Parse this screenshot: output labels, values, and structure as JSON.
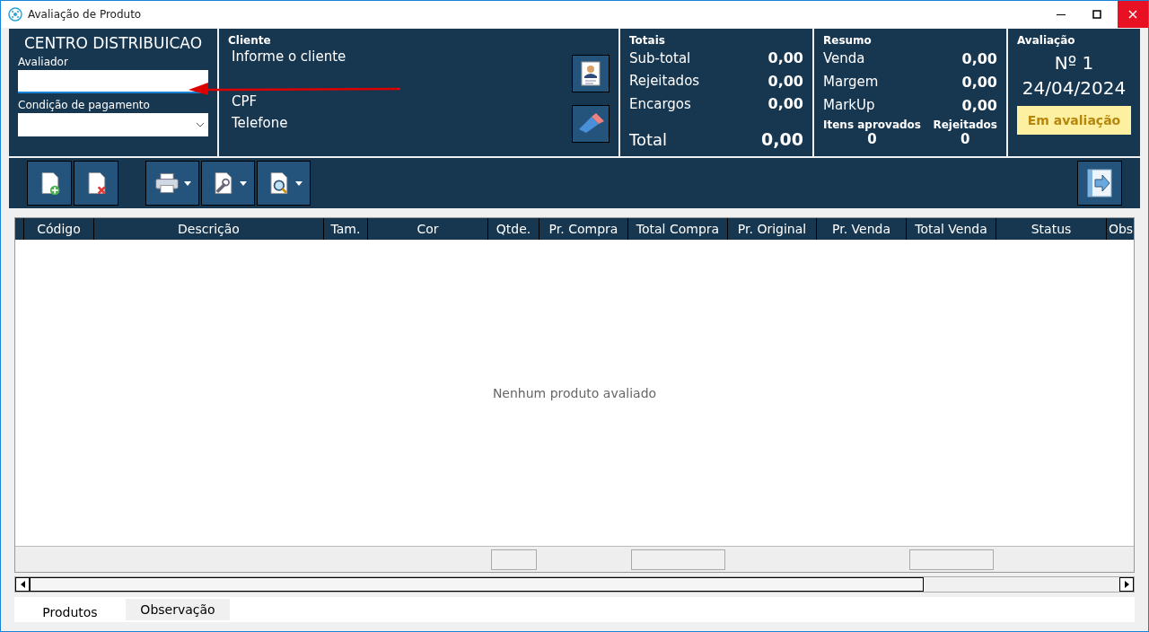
{
  "window": {
    "title": "Avaliação de Produto"
  },
  "centro": {
    "title": "CENTRO DISTRIBUICAO",
    "avaliador_label": "Avaliador",
    "condicao_label": "Condição de pagamento"
  },
  "cliente": {
    "heading": "Cliente",
    "name": "Informe o cliente",
    "cpf_label": "CPF",
    "telefone_label": "Telefone"
  },
  "totais": {
    "heading": "Totais",
    "rows": [
      {
        "label": "Sub-total",
        "value": "0,00"
      },
      {
        "label": "Rejeitados",
        "value": "0,00"
      },
      {
        "label": "Encargos",
        "value": "0,00"
      }
    ],
    "total_label": "Total",
    "total_value": "0,00"
  },
  "resumo": {
    "heading": "Resumo",
    "rows": [
      {
        "label": "Venda",
        "value": "0,00"
      },
      {
        "label": "Margem",
        "value": "0,00"
      },
      {
        "label": "MarkUp",
        "value": "0,00"
      }
    ],
    "counts": [
      {
        "label": "Itens aprovados",
        "value": "0"
      },
      {
        "label": "Rejeitados",
        "value": "0"
      }
    ]
  },
  "avaliacao": {
    "heading": "Avaliação",
    "number": "Nº 1",
    "date": "24/04/2024",
    "status": "Em avaliação"
  },
  "toolbar": [
    {
      "kind": "new",
      "dropdown": false
    },
    {
      "kind": "delete",
      "dropdown": false
    },
    {
      "kind": "print",
      "dropdown": true
    },
    {
      "kind": "tools",
      "dropdown": true
    },
    {
      "kind": "search",
      "dropdown": true
    }
  ],
  "table": {
    "columns": [
      {
        "label": "Código",
        "footer": false
      },
      {
        "label": "Descrição",
        "footer": false
      },
      {
        "label": "Tam.",
        "footer": false
      },
      {
        "label": "Cor",
        "footer": false
      },
      {
        "label": "Qtde.",
        "footer": true
      },
      {
        "label": "Pr. Compra",
        "footer": false
      },
      {
        "label": "Total Compra",
        "footer": true
      },
      {
        "label": "Pr. Original",
        "footer": false
      },
      {
        "label": "Pr. Venda",
        "footer": false
      },
      {
        "label": "Total Venda",
        "footer": true
      },
      {
        "label": "Status",
        "footer": false
      },
      {
        "label": "Obs",
        "footer": false
      }
    ],
    "empty_message": "Nenhum produto avaliado"
  },
  "tabs": [
    {
      "label": "Produtos",
      "selected": true
    },
    {
      "label": "Observação",
      "selected": false
    }
  ]
}
